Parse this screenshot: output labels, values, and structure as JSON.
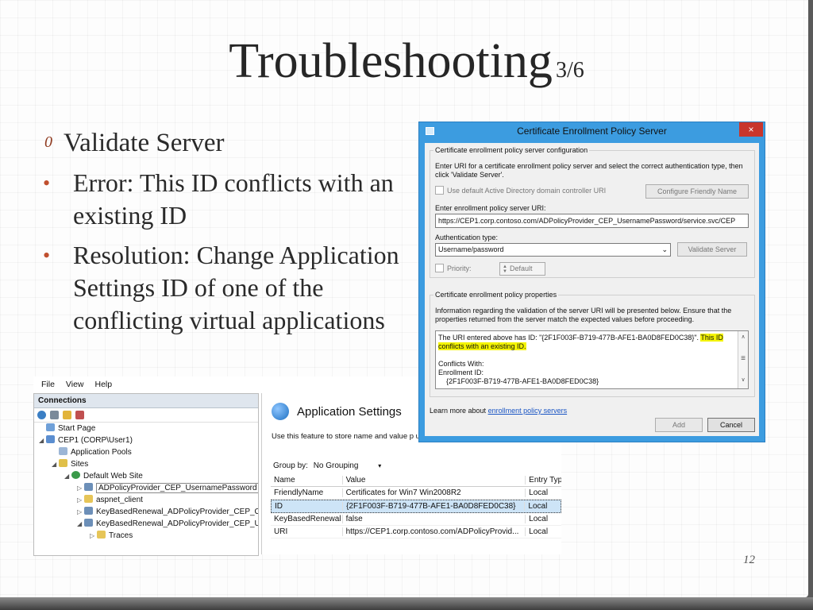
{
  "slide": {
    "title": "Troubleshooting",
    "title_suffix": "3/6",
    "marker": "0",
    "level0": "Validate Server",
    "bullet_char": "•",
    "bullet1": "Error: This ID conflicts with an existing ID",
    "bullet2": "Resolution: Change Application Settings ID of one of the conflicting virtual applications",
    "page_number": "12"
  },
  "iis": {
    "menu": [
      "File",
      "View",
      "Help"
    ],
    "connections_label": "Connections",
    "tree": {
      "start_page": "Start Page",
      "server": "CEP1 (CORP\\User1)",
      "app_pools": "Application Pools",
      "sites": "Sites",
      "default_site": "Default Web Site",
      "app1": "ADPolicyProvider_CEP_UsernamePassword",
      "app2": "aspnet_client",
      "app3": "KeyBasedRenewal_ADPolicyProvider_CEP_Cer",
      "app4": "KeyBasedRenewal_ADPolicyProvider_CEP_Use",
      "app5": "Traces"
    },
    "appsettings": {
      "heading": "Application Settings",
      "description": "Use this feature to store name and value p use at runtime.",
      "group_by_label": "Group by:",
      "group_by_value": "No Grouping",
      "columns": [
        "Name",
        "Value",
        "Entry Typ"
      ],
      "rows": [
        [
          "FriendlyName",
          "Certificates for Win7 Win2008R2",
          "Local"
        ],
        [
          "ID",
          "{2F1F003F-B719-477B-AFE1-BA0D8FED0C38}",
          "Local"
        ],
        [
          "KeyBasedRenewal",
          "false",
          "Local"
        ],
        [
          "URI",
          "https://CEP1.corp.contoso.com/ADPolicyProvid...",
          "Local"
        ]
      ]
    }
  },
  "dialog": {
    "title": "Certificate Enrollment Policy Server",
    "close_glyph": "×",
    "config_group": "Certificate enrollment policy server configuration",
    "config_help": "Enter URI for a certificate enrollment policy server and select the correct authentication type, then click 'Validate Server'.",
    "use_default_label": "Use default Active Directory domain controller URI",
    "configure_friendly_name": "Configure Friendly Name",
    "uri_label": "Enter enrollment policy server URI:",
    "uri_value": "https://CEP1.corp.contoso.com/ADPolicyProvider_CEP_UsernamePassword/service.svc/CEP",
    "auth_label": "Authentication type:",
    "auth_value": "Username/password",
    "validate_server": "Validate Server",
    "priority_label": "Priority:",
    "priority_value": "Default",
    "props_group": "Certificate enrollment policy properties",
    "props_help": "Information regarding the validation of the server URI will be presented below. Ensure that the properties returned from the server match the expected values before proceeding.",
    "result_line1": "The URI entered above has ID: \"{2F1F003F-B719-477B-AFE1-BA0D8FED0C38}\".",
    "result_highlight": "This ID conflicts with an existing ID.",
    "conflicts_with": "Conflicts With:",
    "enrollment_id": "Enrollment ID:",
    "enrollment_id_value": "{2F1F003F-B719-477B-AFE1-BA0D8FED0C38}",
    "learn_more": "Learn more about",
    "learn_more_link": "enrollment policy servers",
    "add_button": "Add",
    "cancel_button": "Cancel"
  }
}
